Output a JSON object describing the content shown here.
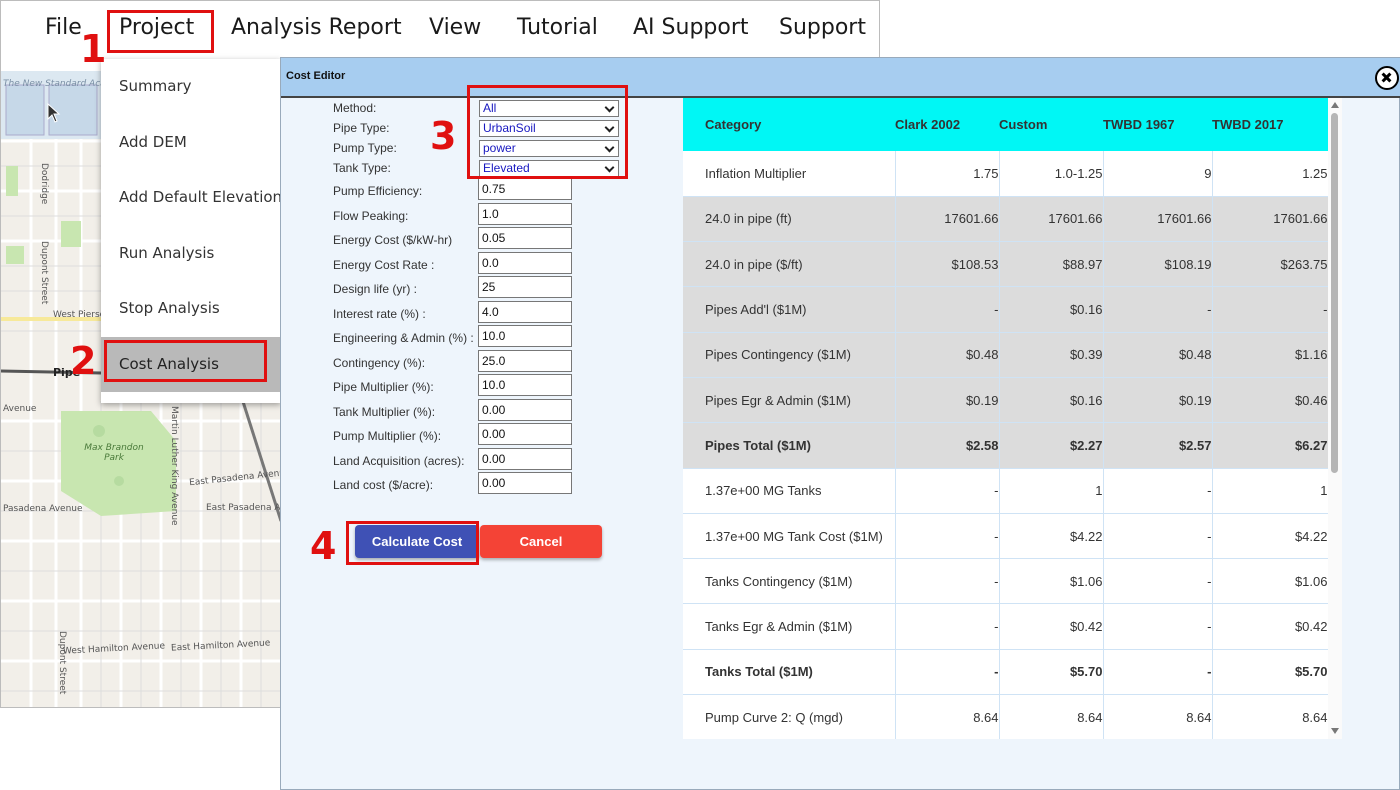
{
  "menubar": {
    "items": [
      "File",
      "Project",
      "Analysis Report",
      "View",
      "Tutorial",
      "AI Support",
      "Support"
    ]
  },
  "project_menu": {
    "items": [
      "Summary",
      "Add DEM",
      "Add Default Elevation",
      "Run Analysis",
      "Stop Analysis",
      "Cost Analysis"
    ],
    "active": "Cost Analysis"
  },
  "map": {
    "labels": [
      "The New Standard Academy",
      "Dodridge",
      "Dupont Street",
      "West Pierson",
      "Pipe",
      "Avenue",
      "Max Brandon Park",
      "Martin Luther King Avenue",
      "East Pasadena Avenue",
      "East Pasadena Ave",
      "Pasadena Avenue",
      "West Hamilton Avenue",
      "East Hamilton Avenue",
      "Dupont Street"
    ]
  },
  "annotations": [
    "1",
    "2",
    "3",
    "4"
  ],
  "editor": {
    "title": "Cost Editor",
    "selects": [
      {
        "label": "Method:",
        "value": "All"
      },
      {
        "label": "Pipe Type:",
        "value": "UrbanSoil"
      },
      {
        "label": "Pump Type:",
        "value": "power"
      },
      {
        "label": "Tank Type:",
        "value": "Elevated"
      }
    ],
    "inputs": [
      {
        "label": "Pump Efficiency:",
        "value": "0.75"
      },
      {
        "label": "Flow Peaking:",
        "value": "1.0"
      },
      {
        "label": "Energy Cost ($/kW-hr)",
        "value": "0.05"
      },
      {
        "label": "Energy Cost Rate :",
        "value": "0.0"
      },
      {
        "label": "Design life (yr) :",
        "value": "25"
      },
      {
        "label": "Interest rate (%) :",
        "value": "4.0"
      },
      {
        "label": "Engineering & Admin (%) :",
        "value": "10.0"
      },
      {
        "label": "Contingency (%):",
        "value": "25.0"
      },
      {
        "label": "Pipe Multiplier (%):",
        "value": "10.0"
      },
      {
        "label": "Tank Multiplier (%):",
        "value": "0.00"
      },
      {
        "label": "Pump Multiplier (%):",
        "value": "0.00"
      },
      {
        "label": "Land Acquisition (acres):",
        "value": "0.00"
      },
      {
        "label": "Land cost ($/acre):",
        "value": "0.00"
      }
    ],
    "calculate_label": "Calculate Cost",
    "cancel_label": "Cancel",
    "colors": {
      "calculate": "#3f51b5",
      "cancel": "#f44336",
      "header": "#a7cdf0",
      "table_header": "#00f7f5"
    }
  },
  "cost_table": {
    "headers": [
      "Category",
      "Clark 2002",
      "Custom",
      "TWBD 1967",
      "TWBD 2017"
    ],
    "rows": [
      {
        "cells": [
          "Inflation Multiplier",
          "1.75",
          "1.0-1.25",
          "9",
          "1.25"
        ],
        "style": "white"
      },
      {
        "cells": [
          "24.0 in pipe (ft)",
          "17601.66",
          "17601.66",
          "17601.66",
          "17601.66"
        ],
        "style": "gray"
      },
      {
        "cells": [
          "24.0 in pipe ($/ft)",
          "$108.53",
          "$88.97",
          "$108.19",
          "$263.75"
        ],
        "style": "gray"
      },
      {
        "cells": [
          "Pipes Add'l ($1M)",
          "-",
          "$0.16",
          "-",
          "-"
        ],
        "style": "gray"
      },
      {
        "cells": [
          "Pipes Contingency ($1M)",
          "$0.48",
          "$0.39",
          "$0.48",
          "$1.16"
        ],
        "style": "gray"
      },
      {
        "cells": [
          "Pipes Egr & Admin ($1M)",
          "$0.19",
          "$0.16",
          "$0.19",
          "$0.46"
        ],
        "style": "gray"
      },
      {
        "cells": [
          "Pipes Total ($1M)",
          "$2.58",
          "$2.27",
          "$2.57",
          "$6.27"
        ],
        "style": "gray-bold"
      },
      {
        "cells": [
          "1.37e+00 MG Tanks",
          "-",
          "1",
          "-",
          "1"
        ],
        "style": "white"
      },
      {
        "cells": [
          "1.37e+00 MG Tank Cost ($1M)",
          "-",
          "$4.22",
          "-",
          "$4.22"
        ],
        "style": "white"
      },
      {
        "cells": [
          "Tanks Contingency ($1M)",
          "-",
          "$1.06",
          "-",
          "$1.06"
        ],
        "style": "white"
      },
      {
        "cells": [
          "Tanks Egr & Admin ($1M)",
          "-",
          "$0.42",
          "-",
          "$0.42"
        ],
        "style": "white"
      },
      {
        "cells": [
          "Tanks Total ($1M)",
          "-",
          "$5.70",
          "-",
          "$5.70"
        ],
        "style": "white-bold"
      },
      {
        "cells": [
          "Pump Curve 2: Q (mgd)",
          "8.64",
          "8.64",
          "8.64",
          "8.64"
        ],
        "style": "white"
      }
    ]
  }
}
